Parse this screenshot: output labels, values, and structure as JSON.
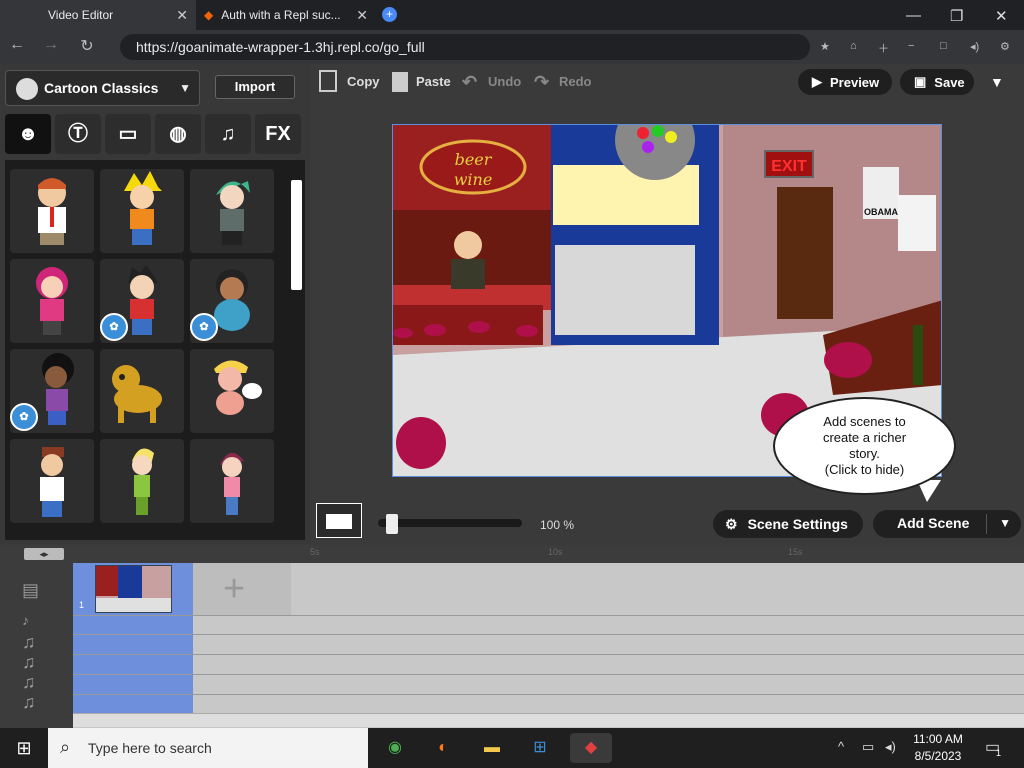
{
  "browser": {
    "tabs": [
      {
        "title": "Video Editor"
      },
      {
        "title": "Auth with a Repl suc..."
      }
    ],
    "url": "https://goanimate-wrapper-1.3hj.repl.co/go_full"
  },
  "left_panel": {
    "theme": "Cartoon Classics",
    "import_label": "Import",
    "categories": [
      {
        "icon": "character-icon"
      },
      {
        "icon": "text-bubble-icon"
      },
      {
        "icon": "background-icon"
      },
      {
        "icon": "prop-ball-icon"
      },
      {
        "icon": "music-note-icon"
      },
      {
        "label": "FX"
      }
    ]
  },
  "toolbar": {
    "copy": "Copy",
    "paste": "Paste",
    "undo": "Undo",
    "redo": "Redo",
    "preview": "Preview",
    "save": "Save"
  },
  "stage": {
    "sign_text_1": "beer",
    "sign_text_2": "wine",
    "exit_sign": "EXIT",
    "poster_text": "OBAMA",
    "tooltip": [
      "Add scenes to",
      "create a richer",
      "story.",
      "(Click to hide)"
    ]
  },
  "zoom": {
    "value_pct": 100,
    "label": "100 %"
  },
  "scene_settings_label": "Scene Settings",
  "add_scene_label": "Add Scene",
  "timeline": {
    "scene_number": "1",
    "ruler_marks": [
      "5s",
      "10s",
      "15s"
    ]
  },
  "taskbar": {
    "search_placeholder": "Type here to search",
    "time": "11:00 AM",
    "date": "8/5/2023",
    "notification_count": "1"
  },
  "colors": {
    "accent_blue": "#5a8fe0",
    "scene_block": "#6d8fdc",
    "stage_badge": "#3b8ed8"
  }
}
